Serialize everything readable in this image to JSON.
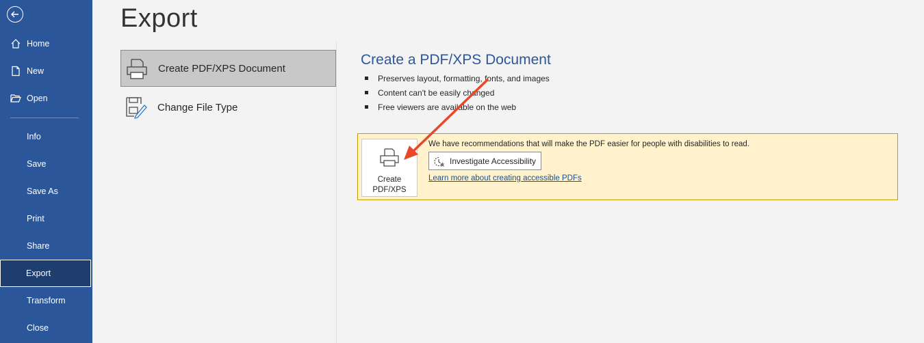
{
  "page": {
    "title": "Export"
  },
  "sidebar": {
    "back_icon": "back-arrow-icon",
    "items": [
      {
        "label": "Home",
        "icon": "home-icon"
      },
      {
        "label": "New",
        "icon": "new-document-icon"
      },
      {
        "label": "Open",
        "icon": "folder-open-icon"
      },
      {
        "label": "Info"
      },
      {
        "label": "Save"
      },
      {
        "label": "Save As"
      },
      {
        "label": "Print"
      },
      {
        "label": "Share"
      },
      {
        "label": "Export",
        "active": true
      },
      {
        "label": "Transform"
      },
      {
        "label": "Close"
      }
    ]
  },
  "export_options": [
    {
      "label": "Create PDF/XPS Document",
      "icon": "pdf-printer-icon",
      "selected": true
    },
    {
      "label": "Change File Type",
      "icon": "change-file-type-icon"
    }
  ],
  "detail": {
    "title": "Create a PDF/XPS Document",
    "bullets": [
      "Preserves layout, formatting, fonts, and images",
      "Content can't be easily changed",
      "Free viewers are available on the web"
    ]
  },
  "notice": {
    "create_button_label_line1": "Create",
    "create_button_label_line2": "PDF/XPS",
    "message": "We have recommendations that will make the PDF easier for people with disabilities to read.",
    "investigate_button": "Investigate Accessibility",
    "learn_link": "Learn more about creating accessible PDFs"
  },
  "colors": {
    "sidebar_bg": "#2b579a",
    "sidebar_active_bg": "#1e3e6f",
    "accent_title": "#2b579a",
    "notice_bg": "#fff2cc",
    "notice_border": "#c19c00",
    "annotation_arrow": "#e8472a"
  }
}
